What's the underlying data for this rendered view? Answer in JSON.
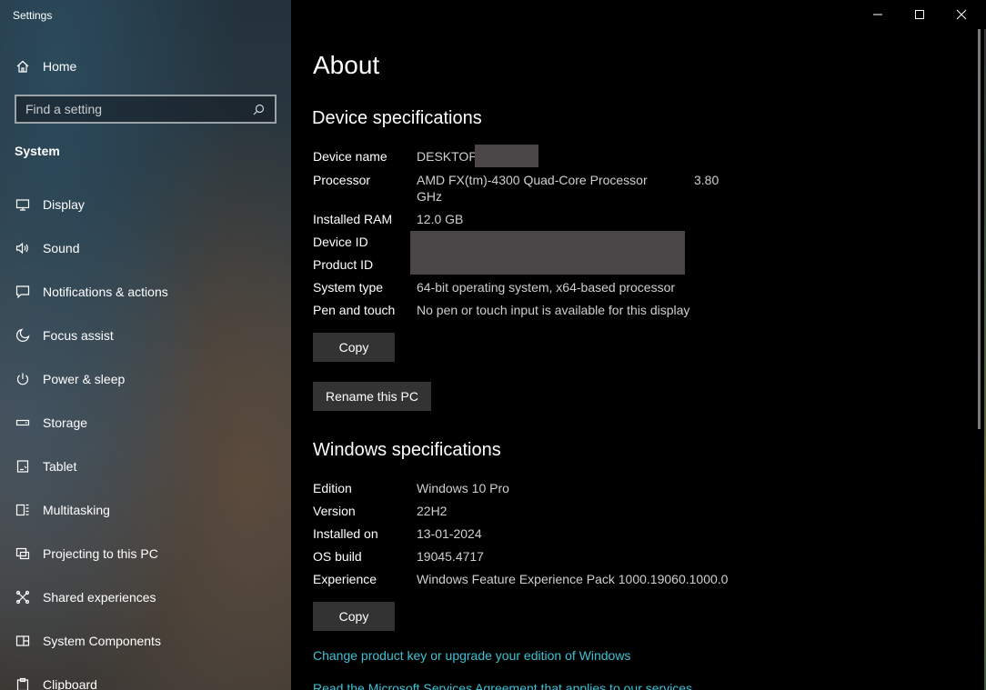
{
  "window": {
    "title": "Settings"
  },
  "sidebar": {
    "home_label": "Home",
    "search_placeholder": "Find a setting",
    "section_title": "System",
    "items": [
      {
        "label": "Display",
        "icon": "display-icon"
      },
      {
        "label": "Sound",
        "icon": "sound-icon"
      },
      {
        "label": "Notifications & actions",
        "icon": "notifications-icon"
      },
      {
        "label": "Focus assist",
        "icon": "moon-icon"
      },
      {
        "label": "Power & sleep",
        "icon": "power-icon"
      },
      {
        "label": "Storage",
        "icon": "storage-icon"
      },
      {
        "label": "Tablet",
        "icon": "tablet-icon"
      },
      {
        "label": "Multitasking",
        "icon": "multitasking-icon"
      },
      {
        "label": "Projecting to this PC",
        "icon": "projecting-icon"
      },
      {
        "label": "Shared experiences",
        "icon": "shared-icon"
      },
      {
        "label": "System Components",
        "icon": "components-icon"
      },
      {
        "label": "Clipboard",
        "icon": "clipboard-icon"
      }
    ]
  },
  "main": {
    "title": "About",
    "device": {
      "heading": "Device specifications",
      "rows": {
        "device_name": {
          "k": "Device name",
          "v": "DESKTOP-"
        },
        "processor": {
          "k": "Processor",
          "v": "AMD FX(tm)-4300 Quad-Core Processor",
          "v_speed": "3.80",
          "v2": "GHz"
        },
        "ram": {
          "k": "Installed RAM",
          "v": "12.0 GB"
        },
        "device_id": {
          "k": "Device ID"
        },
        "product_id": {
          "k": "Product ID"
        },
        "system_type": {
          "k": "System type",
          "v": "64-bit operating system, x64-based processor"
        },
        "pen_touch": {
          "k": "Pen and touch",
          "v": "No pen or touch input is available for this display"
        }
      },
      "copy_label": "Copy",
      "rename_label": "Rename this PC"
    },
    "windows": {
      "heading": "Windows specifications",
      "rows": {
        "edition": {
          "k": "Edition",
          "v": "Windows 10 Pro"
        },
        "version": {
          "k": "Version",
          "v": "22H2"
        },
        "installed_on": {
          "k": "Installed on",
          "v": "13-01-2024"
        },
        "os_build": {
          "k": "OS build",
          "v": "19045.4717"
        },
        "experience": {
          "k": "Experience",
          "v": "Windows Feature Experience Pack 1000.19060.1000.0"
        }
      },
      "copy_label": "Copy",
      "link1": "Change product key or upgrade your edition of Windows",
      "link2": "Read the Microsoft Services Agreement that applies to our services"
    }
  }
}
